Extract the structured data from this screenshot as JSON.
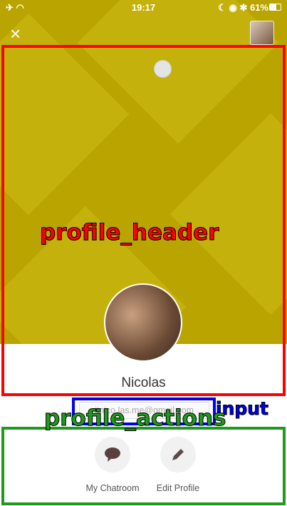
{
  "status_bar": {
    "left_icons": "✈ ◠",
    "time": "19:17",
    "right": "☾ ◉ ✱ 61%",
    "battery_percent": 61
  },
  "header": {
    "close_icon": "×"
  },
  "profile": {
    "name": "Nicolas"
  },
  "email_input": {
    "value": "itnico.las.me@gmail.com"
  },
  "actions": [
    {
      "label": "My Chatroom",
      "icon": "speech-bubble-icon"
    },
    {
      "label": "Edit Profile",
      "icon": "pencil-icon"
    }
  ],
  "annotations": [
    {
      "label": "profile_header",
      "color": "#ff0000"
    },
    {
      "label": "input",
      "color": "#0000ee"
    },
    {
      "label": "profile_actions",
      "color": "#1e9a1e"
    }
  ]
}
